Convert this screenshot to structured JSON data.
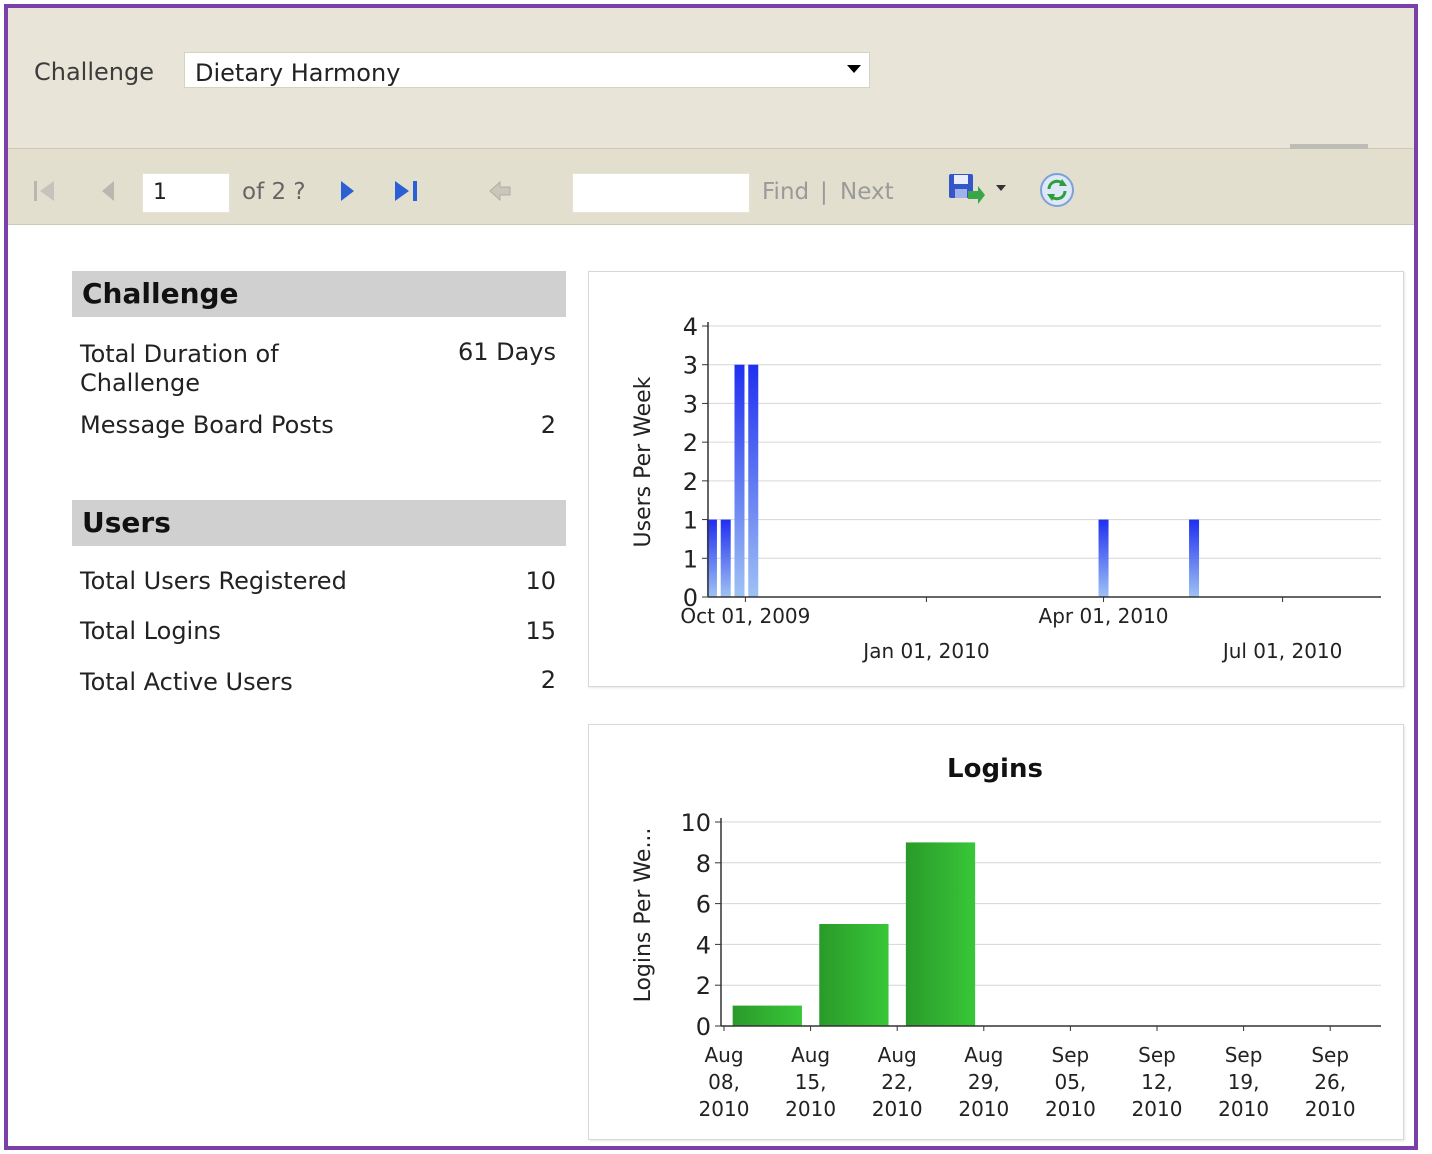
{
  "parameter": {
    "label": "Challenge",
    "selected": "Dietary Harmony"
  },
  "toolbar": {
    "page_value": "1",
    "of_pages": "of 2 ?",
    "find_label": "Find",
    "separator": "|",
    "next_label": "Next",
    "icons": [
      "first-page-icon",
      "previous-page-icon",
      "next-page-icon",
      "last-page-icon",
      "back-icon",
      "save-export-icon",
      "dropdown-arrow-icon",
      "refresh-icon"
    ]
  },
  "challenge_section": {
    "title": "Challenge",
    "rows": [
      {
        "label": "Total Duration of Challenge",
        "value": "61 Days"
      },
      {
        "label": "Message Board Posts",
        "value": "2"
      }
    ]
  },
  "users_section": {
    "title": "Users",
    "rows": [
      {
        "label": "Total Users Registered",
        "value": "10"
      },
      {
        "label": "Total Logins",
        "value": "15"
      },
      {
        "label": "Total Active Users",
        "value": "2"
      }
    ]
  },
  "chart_data": [
    {
      "type": "bar",
      "title": "",
      "ylabel": "Users Per Week",
      "xlabel": "",
      "y_ticks": [
        "0",
        "1",
        "1",
        "2",
        "2",
        "3",
        "3",
        "4"
      ],
      "ylim": [
        0,
        3.5
      ],
      "x_ticks": [
        "Oct 01, 2009",
        "Jan 01, 2010",
        "Apr 01, 2010",
        "Jul 01, 2010"
      ],
      "x_tick_dates": [
        "2009-10-01",
        "2010-01-01",
        "2010-04-01",
        "2010-07-01"
      ],
      "xlim": [
        "2009-09-12",
        "2010-08-20"
      ],
      "points": [
        {
          "x": "2009-09-14",
          "y": 1
        },
        {
          "x": "2009-09-21",
          "y": 1
        },
        {
          "x": "2009-09-28",
          "y": 3
        },
        {
          "x": "2009-10-05",
          "y": 3
        },
        {
          "x": "2010-04-01",
          "y": 1
        },
        {
          "x": "2010-05-17",
          "y": 1
        }
      ],
      "color": "#1f2ff0",
      "grid": true
    },
    {
      "type": "bar",
      "title": "Logins",
      "ylabel": "Logins Per We...",
      "xlabel": "",
      "ylim": [
        0,
        10
      ],
      "y_ticks": [
        0,
        2,
        4,
        6,
        8,
        10
      ],
      "categories": [
        "Aug 08, 2010",
        "Aug 15, 2010",
        "Aug 22, 2010",
        "Aug 29, 2010",
        "Sep 05, 2010",
        "Sep 12, 2010",
        "Sep 19, 2010",
        "Sep 26, 2010"
      ],
      "category_lines": [
        [
          "Aug",
          "08,",
          "2010"
        ],
        [
          "Aug",
          "15,",
          "2010"
        ],
        [
          "Aug",
          "22,",
          "2010"
        ],
        [
          "Aug",
          "29,",
          "2010"
        ],
        [
          "Sep",
          "05,",
          "2010"
        ],
        [
          "Sep",
          "12,",
          "2010"
        ],
        [
          "Sep",
          "19,",
          "2010"
        ],
        [
          "Sep",
          "26,",
          "2010"
        ]
      ],
      "bars": [
        {
          "x": "Aug 15, 2010",
          "y": 1
        },
        {
          "x": "Aug 22, 2010",
          "y": 5
        },
        {
          "x": "Aug 29, 2010",
          "y": 9
        }
      ],
      "color": "#22a022",
      "grid": true
    }
  ]
}
